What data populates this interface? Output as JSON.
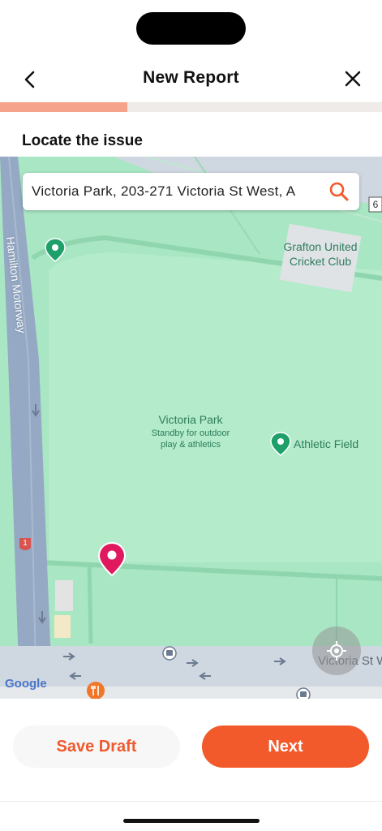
{
  "header": {
    "title": "New Report"
  },
  "progress": {
    "fraction": 0.333,
    "fill_color": "#f6a38c",
    "track_color": "#eeebe8"
  },
  "section": {
    "label": "Locate the issue"
  },
  "search": {
    "value": "Victoria Park, 203-271 Victoria St West, A"
  },
  "map": {
    "labels": {
      "motorway": "Hamilton Motorway",
      "park_name": "Victoria Park",
      "park_sub1": "Standby for outdoor",
      "park_sub2": "play & athletics",
      "athletic_field": "Athletic Field",
      "cricket1": "Grafton United",
      "cricket2": "Cricket Club",
      "street": "Victoria St W",
      "route_number": "1",
      "side_number": "6",
      "google": "Google"
    }
  },
  "actions": {
    "save_draft": "Save Draft",
    "next": "Next"
  },
  "colors": {
    "accent": "#f2592b",
    "pin": "#e0195f",
    "map_green": "#a9e6c3"
  }
}
